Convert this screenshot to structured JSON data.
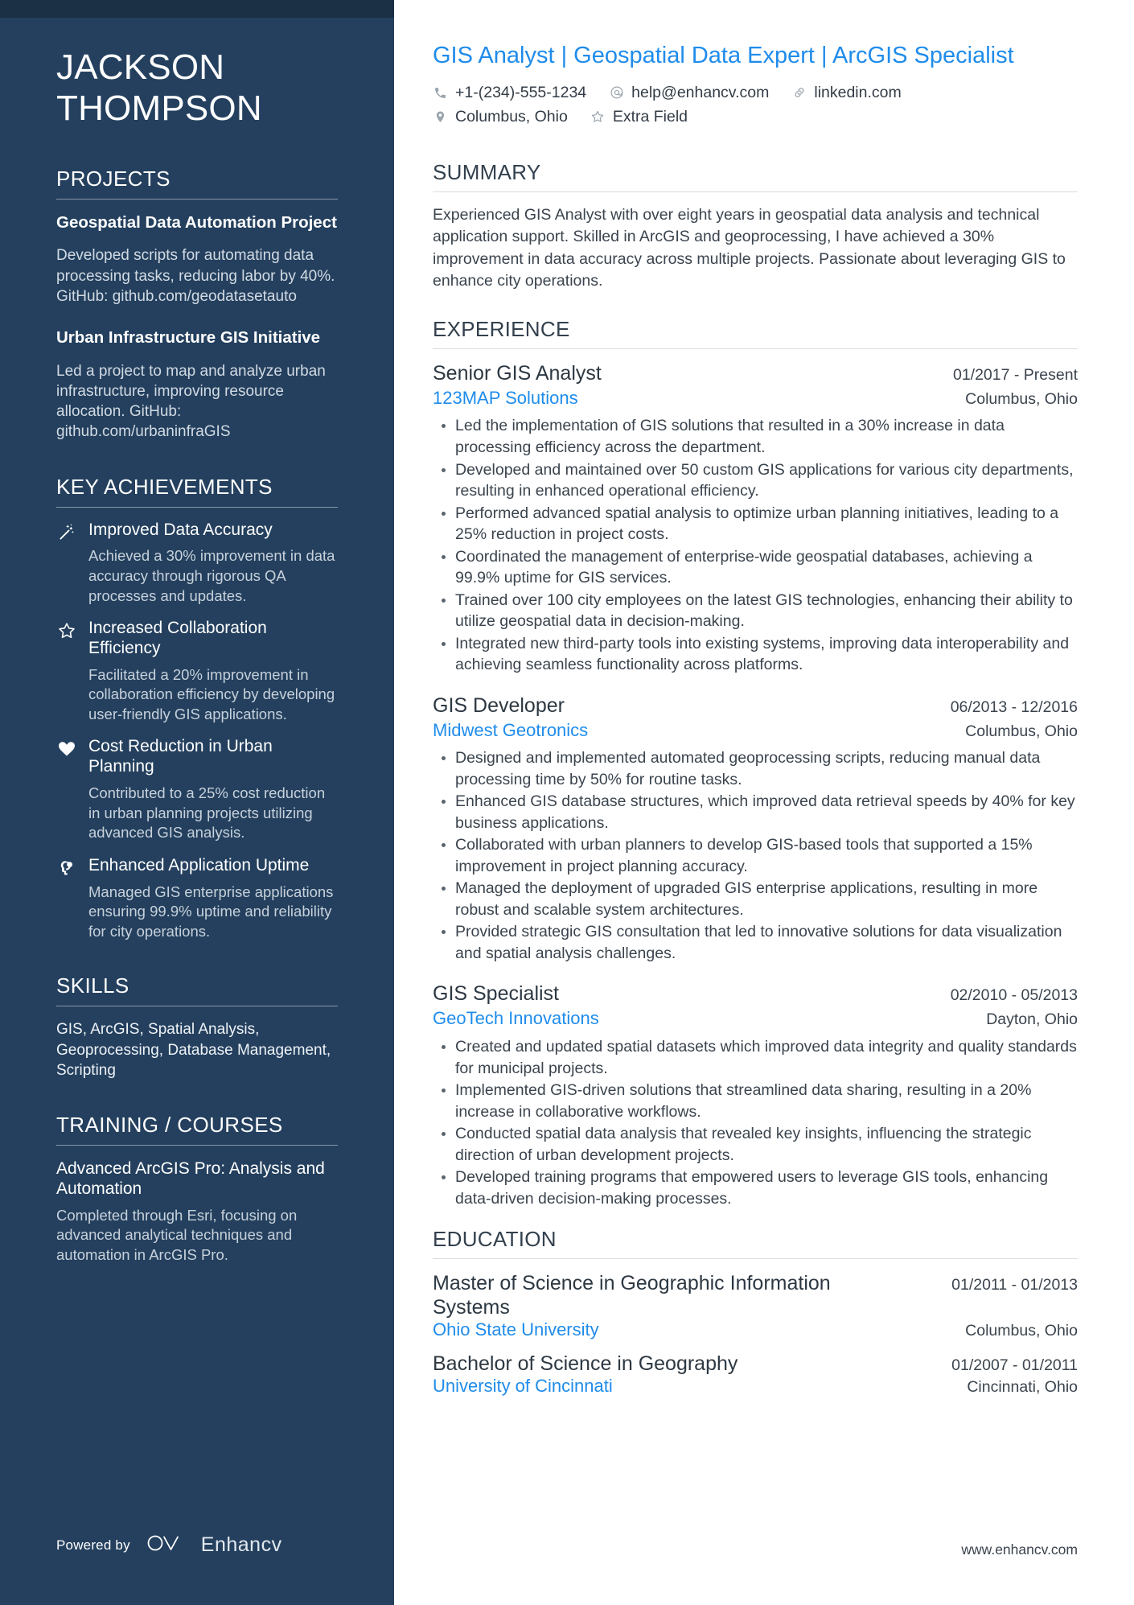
{
  "sidebar": {
    "name_lines": [
      "JACKSON",
      "THOMPSON"
    ],
    "projects": {
      "heading": "PROJECTS",
      "items": [
        {
          "title": "Geospatial Data Automation Project",
          "description": "Developed scripts for automating data processing tasks, reducing labor by 40%. GitHub: github.com/geodatasetauto"
        },
        {
          "title": "Urban Infrastructure GIS Initiative",
          "description": "Led a project to map and analyze urban infrastructure, improving resource allocation. GitHub: github.com/urbaninfraGIS"
        }
      ]
    },
    "achievements": {
      "heading": "KEY ACHIEVEMENTS",
      "items": [
        {
          "icon": "magic-wand-icon",
          "title": "Improved Data Accuracy",
          "description": "Achieved a 30% improvement in data accuracy through rigorous QA processes and updates."
        },
        {
          "icon": "star-icon",
          "title": "Increased Collaboration Efficiency",
          "description": "Facilitated a 20% improvement in collaboration efficiency by developing user-friendly GIS applications."
        },
        {
          "icon": "heart-icon",
          "title": "Cost Reduction in Urban Planning",
          "description": "Contributed to a 25% cost reduction in urban planning projects utilizing advanced GIS analysis."
        },
        {
          "icon": "idea-head-icon",
          "title": "Enhanced Application Uptime",
          "description": "Managed GIS enterprise applications ensuring 99.9% uptime and reliability for city operations."
        }
      ]
    },
    "skills": {
      "heading": "SKILLS",
      "text": "GIS, ArcGIS, Spatial Analysis, Geoprocessing, Database Management, Scripting"
    },
    "training": {
      "heading": "TRAINING / COURSES",
      "items": [
        {
          "title": "Advanced ArcGIS Pro: Analysis and Automation",
          "description": "Completed through Esri, focusing on advanced analytical techniques and automation in ArcGIS Pro."
        }
      ]
    },
    "powered_by": {
      "label": "Powered by",
      "brand": "Enhancv"
    }
  },
  "main": {
    "headline": "GIS Analyst | Geospatial Data Expert | ArcGIS Specialist",
    "contact": [
      {
        "icon": "phone-icon",
        "text": "+1-(234)-555-1234"
      },
      {
        "icon": "email-icon",
        "text": "help@enhancv.com"
      },
      {
        "icon": "link-icon",
        "text": "linkedin.com"
      },
      {
        "icon": "location-pin-icon",
        "text": "Columbus, Ohio"
      },
      {
        "icon": "star-outline-icon",
        "text": "Extra Field"
      }
    ],
    "summary": {
      "heading": "SUMMARY",
      "text": "Experienced GIS Analyst with over eight years in geospatial data analysis and technical application support. Skilled in ArcGIS and geoprocessing, I have achieved a 30% improvement in data accuracy across multiple projects. Passionate about leveraging GIS to enhance city operations."
    },
    "experience": {
      "heading": "EXPERIENCE",
      "entries": [
        {
          "title": "Senior GIS Analyst",
          "dates": "01/2017 - Present",
          "org": "123MAP Solutions",
          "location": "Columbus, Ohio",
          "bullets": [
            "Led the implementation of GIS solutions that resulted in a 30% increase in data processing efficiency across the department.",
            "Developed and maintained over 50 custom GIS applications for various city departments, resulting in enhanced operational efficiency.",
            "Performed advanced spatial analysis to optimize urban planning initiatives, leading to a 25% reduction in project costs.",
            "Coordinated the management of enterprise-wide geospatial databases, achieving a 99.9% uptime for GIS services.",
            "Trained over 100 city employees on the latest GIS technologies, enhancing their ability to utilize geospatial data in decision-making.",
            "Integrated new third-party tools into existing systems, improving data interoperability and achieving seamless functionality across platforms."
          ]
        },
        {
          "title": "GIS Developer",
          "dates": "06/2013 - 12/2016",
          "org": "Midwest Geotronics",
          "location": "Columbus, Ohio",
          "bullets": [
            "Designed and implemented automated geoprocessing scripts, reducing manual data processing time by 50% for routine tasks.",
            "Enhanced GIS database structures, which improved data retrieval speeds by 40% for key business applications.",
            "Collaborated with urban planners to develop GIS-based tools that supported a 15% improvement in project planning accuracy.",
            "Managed the deployment of upgraded GIS enterprise applications, resulting in more robust and scalable system architectures.",
            "Provided strategic GIS consultation that led to innovative solutions for data visualization and spatial analysis challenges."
          ]
        },
        {
          "title": "GIS Specialist",
          "dates": "02/2010 - 05/2013",
          "org": "GeoTech Innovations",
          "location": "Dayton, Ohio",
          "bullets": [
            "Created and updated spatial datasets which improved data integrity and quality standards for municipal projects.",
            "Implemented GIS-driven solutions that streamlined data sharing, resulting in a 20% increase in collaborative workflows.",
            "Conducted spatial data analysis that revealed key insights, influencing the strategic direction of urban development projects.",
            "Developed training programs that empowered users to leverage GIS tools, enhancing data-driven decision-making processes."
          ]
        }
      ]
    },
    "education": {
      "heading": "EDUCATION",
      "entries": [
        {
          "title": "Master of Science in Geographic Information Systems",
          "dates": "01/2011 - 01/2013",
          "org": "Ohio State University",
          "location": "Columbus, Ohio"
        },
        {
          "title": "Bachelor of Science in Geography",
          "dates": "01/2007 - 01/2011",
          "org": "University of Cincinnati",
          "location": "Cincinnati, Ohio"
        }
      ]
    },
    "footer_url": "www.enhancv.com"
  },
  "colors": {
    "sidebar_bg": "#24405e",
    "sidebar_topbar": "#1b2f45",
    "accent_blue": "#1f8ceb",
    "body_text": "#3b444e"
  }
}
